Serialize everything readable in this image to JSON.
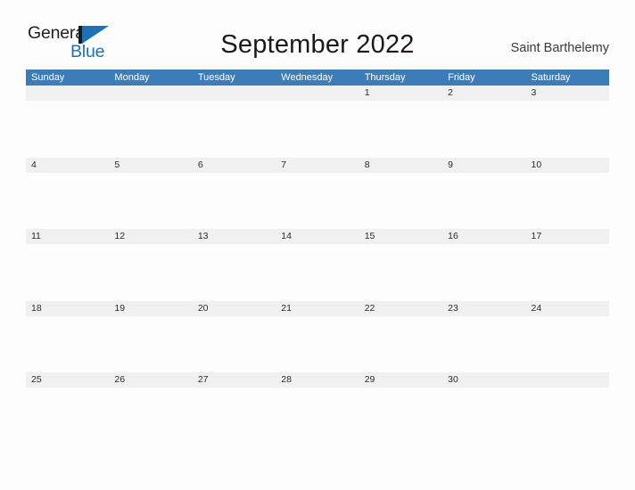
{
  "brand": {
    "word_one": "General",
    "word_two": "Blue",
    "flag_icon": "blue-flag-icon",
    "accent_color": "#1c72b8"
  },
  "header": {
    "title": "September 2022",
    "location": "Saint Barthelemy"
  },
  "theme": {
    "header_blue": "#3c7cb8",
    "rule_blue": "#2e6da4",
    "band_gray": "#f0f0f0",
    "page_background": "#fdfdfe",
    "text_color": "#2b2b2b"
  },
  "calendar": {
    "month": "September",
    "year": "2022",
    "weekday_headers": [
      "Sunday",
      "Monday",
      "Tuesday",
      "Wednesday",
      "Thursday",
      "Friday",
      "Saturday"
    ],
    "weeks": [
      {
        "rule_columns": 7,
        "days": [
          "",
          "",
          "",
          "",
          "1",
          "2",
          "3"
        ]
      },
      {
        "rule_columns": 7,
        "days": [
          "4",
          "5",
          "6",
          "7",
          "8",
          "9",
          "10"
        ]
      },
      {
        "rule_columns": 7,
        "days": [
          "11",
          "12",
          "13",
          "14",
          "15",
          "16",
          "17"
        ]
      },
      {
        "rule_columns": 7,
        "days": [
          "18",
          "19",
          "20",
          "21",
          "22",
          "23",
          "24"
        ]
      },
      {
        "rule_columns": 6,
        "days": [
          "25",
          "26",
          "27",
          "28",
          "29",
          "30",
          ""
        ]
      }
    ]
  }
}
